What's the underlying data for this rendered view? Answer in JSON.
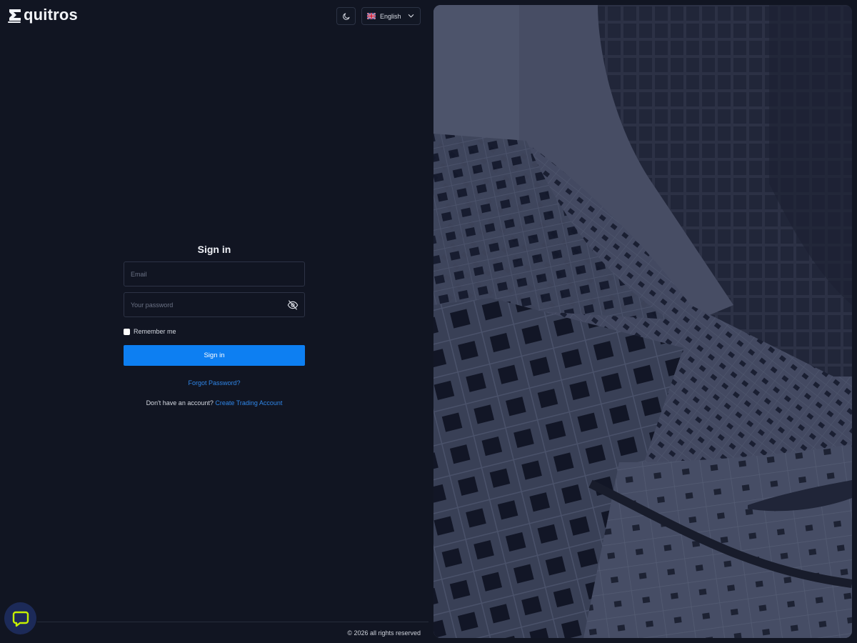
{
  "brand": {
    "name": "quitros",
    "logo_icon": "equitros-e-logo-icon"
  },
  "header": {
    "theme_icon": "moon-icon",
    "language": {
      "flag_icon": "uk-flag-icon",
      "selected": "English",
      "chevron_icon": "chevron-down-icon"
    }
  },
  "form": {
    "title": "Sign in",
    "email": {
      "placeholder": "Email",
      "value": ""
    },
    "password": {
      "placeholder": "Your password",
      "value": "",
      "toggle_icon": "eye-off-icon"
    },
    "remember_label": "Remember me",
    "submit_label": "Sign in",
    "forgot_label": "Forgot Password?",
    "signup_prompt": "Don't have an account?",
    "signup_link": "Create Trading Account"
  },
  "footer": {
    "copyright": "© 2026 all rights reserved"
  },
  "chat": {
    "icon": "chat-bubble-icon"
  },
  "colors": {
    "background": "#111522",
    "primary": "#0d7ff2",
    "link": "#2f86e8",
    "chat_bg": "#1c2a58",
    "chat_icon": "#c6f000"
  }
}
